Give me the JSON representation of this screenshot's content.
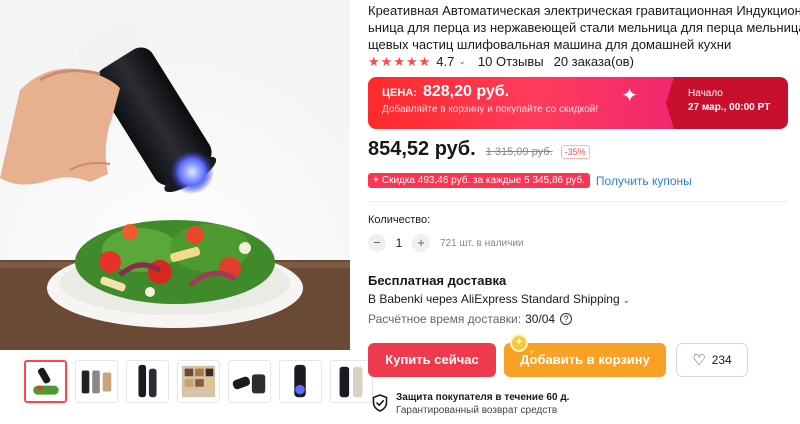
{
  "product": {
    "title_lines": [
      "Креативная Автоматическая электрическая гравитационная Индукционная мел",
      "ьница для перца из нержавеющей стали мельница для перца мельница для пи",
      "щевых частиц шлифовальная машина для домашней кухни"
    ],
    "rating": "4.7",
    "reviews": "10 Отзывы",
    "orders": "20 заказа(ов)",
    "star_color": "#ff4747"
  },
  "promo": {
    "price_label": "ЦЕНА:",
    "price": "828,20 руб.",
    "subtitle": "Добавляйте в корзину и покупайте со скидкой!",
    "start_label": "Начало",
    "start_date": "27 мар., 00:00 PT"
  },
  "pricing": {
    "price": "854,52 руб.",
    "old_price": "1 315,09 руб.",
    "discount": "-35%",
    "coupon_text": "Скидка 493,46 руб. за каждые 5 345,86 руб.",
    "coupon_plus": "+",
    "get_coupons": "Получить купоны"
  },
  "quantity": {
    "label": "Количество:",
    "minus": "−",
    "value": "1",
    "plus": "+",
    "stock": "721 шт. в наличии"
  },
  "shipping": {
    "title": "Бесплатная доставка",
    "method": "В Babenki через AliExpress Standard Shipping",
    "eta_label": "Расчётное время доставки:",
    "eta": "30/04",
    "help": "?"
  },
  "actions": {
    "buy_now": "Купить сейчас",
    "add_to_cart": "Добавить в корзину",
    "wishlist_count": "234",
    "buy_color": "#ef3a4e",
    "cart_color": "#f8a125"
  },
  "protection": {
    "title": "Защита покупателя в течение 60 д.",
    "subtitle": "Гарантированный возврат средств"
  },
  "icons": {
    "wishlist": "heart-icon",
    "shield": "shield-check-icon",
    "help": "question-circle-icon",
    "sparkle": "sparkle-icon",
    "chevron": "chevron-down-icon"
  }
}
